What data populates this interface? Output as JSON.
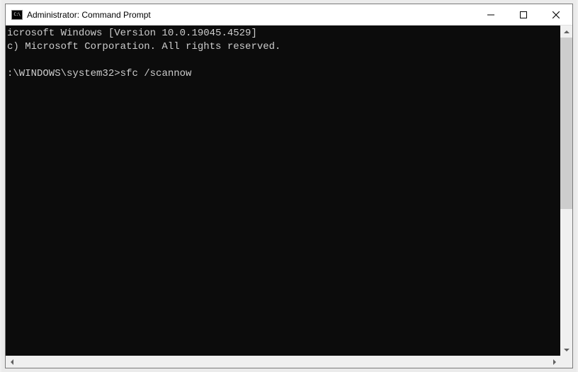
{
  "window": {
    "title": "Administrator: Command Prompt"
  },
  "console": {
    "line1": "icrosoft Windows [Version 10.0.19045.4529]",
    "line2": "c) Microsoft Corporation. All rights reserved.",
    "blank": "",
    "prompt": ":\\WINDOWS\\system32>",
    "command": "sfc /scannow"
  }
}
